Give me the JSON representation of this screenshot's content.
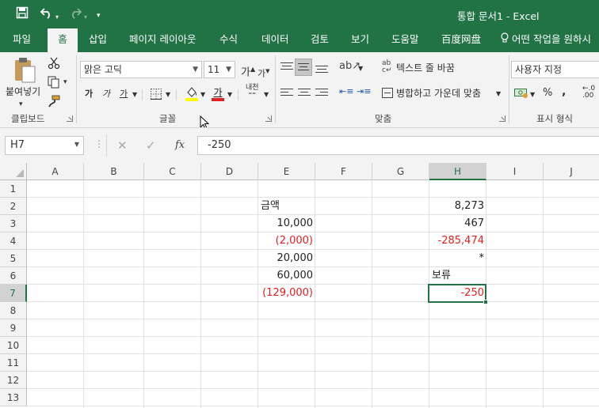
{
  "window": {
    "title": "통합 문서1  -  Excel",
    "accent_color": "#217346"
  },
  "qat": {
    "save_icon": "save-icon",
    "undo_icon": "undo-icon",
    "redo_icon": "redo-icon",
    "customize_icon": "customize-qat-icon"
  },
  "tabs": [
    {
      "label": "파일"
    },
    {
      "label": "홈"
    },
    {
      "label": "삽입"
    },
    {
      "label": "페이지 레이아웃"
    },
    {
      "label": "수식"
    },
    {
      "label": "데이터"
    },
    {
      "label": "검토"
    },
    {
      "label": "보기"
    },
    {
      "label": "도움말"
    },
    {
      "label": "百度网盘"
    },
    {
      "label": "어떤 작업을 원하시"
    }
  ],
  "active_tab": "홈",
  "ribbon": {
    "clipboard": {
      "paste_label": "붙여넣기",
      "group_label": "클립보드"
    },
    "font": {
      "font_name": "맑은 고딕",
      "font_size": "11",
      "grow_label": "가",
      "shrink_label": "가",
      "bold_label": "가",
      "italic_label": "가",
      "underline_label": "가",
      "font_color_label": "가",
      "phonetic_label": "내천",
      "group_label": "글꼴",
      "font_color": "#e02020",
      "fill_color": "#ffff00"
    },
    "alignment": {
      "wrap_label": "텍스트 줄 바꿈",
      "merge_label": "병합하고 가운데 맞춤",
      "group_label": "맞춤"
    },
    "number": {
      "format_value": "사용자 지정",
      "percent_label": "%",
      "comma_label": ",",
      "group_label": "표시 형식"
    }
  },
  "formula_bar": {
    "name_box": "H7",
    "fx_label": "fx",
    "content": "-250"
  },
  "sheet": {
    "columns": [
      "A",
      "B",
      "C",
      "D",
      "E",
      "F",
      "G",
      "H",
      "I",
      "J"
    ],
    "rows": [
      "1",
      "2",
      "3",
      "4",
      "5",
      "6",
      "7",
      "8",
      "9",
      "10",
      "11",
      "12",
      "13"
    ],
    "selected_cell": "H7",
    "negative_color": "#e02020",
    "cells": {
      "E2": "금액",
      "E3": "10,000",
      "E4": "(2,000)",
      "E5": "20,000",
      "E6": "60,000",
      "E7": "(129,000)",
      "H2": "8,273",
      "H3": "467",
      "H4": "-285,474",
      "H5": "*",
      "H6": "보류",
      "H7": "-250"
    }
  }
}
